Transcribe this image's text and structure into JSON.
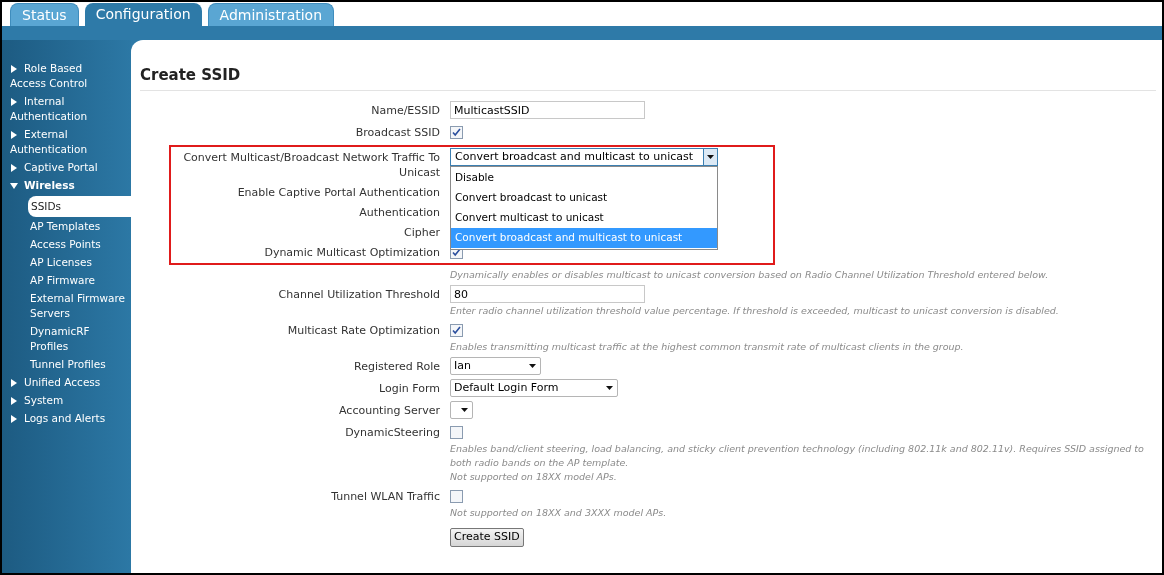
{
  "tabs": [
    {
      "label": "Status",
      "selected": false
    },
    {
      "label": "Configuration",
      "selected": true
    },
    {
      "label": "Administration",
      "selected": false
    }
  ],
  "sidebar": {
    "items": [
      {
        "label": "Role Based Access Control",
        "expanded": false
      },
      {
        "label": "Internal Authentication",
        "expanded": false
      },
      {
        "label": "External Authentication",
        "expanded": false
      },
      {
        "label": "Captive Portal",
        "expanded": false
      },
      {
        "label": "Wireless",
        "expanded": true,
        "children": [
          {
            "label": "SSIDs",
            "selected": true
          },
          {
            "label": "AP Templates",
            "selected": false
          },
          {
            "label": "Access Points",
            "selected": false
          },
          {
            "label": "AP Licenses",
            "selected": false
          },
          {
            "label": "AP Firmware",
            "selected": false
          },
          {
            "label": "External Firmware Servers",
            "selected": false
          },
          {
            "label": "DynamicRF Profiles",
            "selected": false
          },
          {
            "label": "Tunnel Profiles",
            "selected": false
          }
        ]
      },
      {
        "label": "Unified Access",
        "expanded": false
      },
      {
        "label": "System",
        "expanded": false
      },
      {
        "label": "Logs and Alerts",
        "expanded": false
      }
    ]
  },
  "page": {
    "title": "Create SSID",
    "fields": [
      {
        "kind": "text",
        "label": "Name/ESSID",
        "value": "MulticastSSID",
        "highlighted": false
      },
      {
        "kind": "checkbox",
        "label": "Broadcast SSID",
        "checked": true,
        "highlighted": false
      },
      {
        "kind": "select",
        "label": "Convert Multicast/Broadcast Network Traffic To Unicast",
        "value": "Convert broadcast and multicast to unicast",
        "highlighted": true,
        "expanded": true,
        "options": [
          {
            "label": "Disable",
            "selected": false
          },
          {
            "label": "Convert broadcast to unicast",
            "selected": false
          },
          {
            "label": "Convert multicast to unicast",
            "selected": false
          },
          {
            "label": "Convert broadcast and multicast to unicast",
            "selected": true
          }
        ]
      },
      {
        "kind": "covered",
        "label": "Enable Captive Portal Authentication",
        "highlighted": true
      },
      {
        "kind": "covered",
        "label": "Authentication",
        "highlighted": true
      },
      {
        "kind": "covered",
        "label": "Cipher",
        "highlighted": true
      },
      {
        "kind": "checkbox",
        "label": "Dynamic Multicast Optimization",
        "checked": true,
        "highlighted": true
      },
      {
        "kind": "hint",
        "hints": [
          "Dynamically enables or disables multicast to unicast conversion based on Radio Channel Utilization Threshold entered below."
        ],
        "highlighted": false
      },
      {
        "kind": "text",
        "label": "Channel Utilization Threshold",
        "value": "80",
        "highlighted": false,
        "hints": [
          "Enter radio channel utilization threshold value percentage. If threshold is exceeded, multicast to unicast conversion is disabled."
        ]
      },
      {
        "kind": "checkbox",
        "label": "Multicast Rate Optimization",
        "checked": true,
        "highlighted": false,
        "hints": [
          "Enables transmitting multicast traffic at the highest common transmit rate of multicast clients in the group."
        ]
      },
      {
        "kind": "select",
        "label": "Registered Role",
        "value": "Ian",
        "highlighted": false,
        "expanded": false
      },
      {
        "kind": "select",
        "label": "Login Form",
        "value": "Default Login Form",
        "highlighted": false,
        "expanded": false
      },
      {
        "kind": "select",
        "label": "Accounting Server",
        "highlighted": false,
        "expanded": false
      },
      {
        "kind": "checkbox",
        "label": "DynamicSteering",
        "checked": false,
        "highlighted": false,
        "hints": [
          "Enables band/client steering, load balancing, and sticky client prevention technology (including 802.11k and 802.11v). Requires SSID assigned to both radio bands on the AP template.",
          "Not supported on 18XX model APs."
        ]
      },
      {
        "kind": "checkbox",
        "label": "Tunnel WLAN Traffic",
        "checked": false,
        "highlighted": false,
        "hints": [
          "Not supported on 18XX and 3XXX model APs."
        ]
      }
    ],
    "submit": "Create SSID"
  }
}
